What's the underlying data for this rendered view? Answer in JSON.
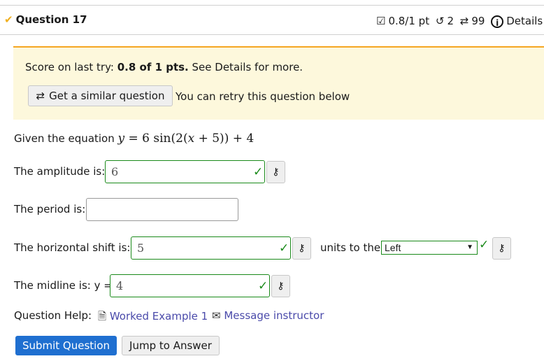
{
  "header": {
    "title": "Question 17",
    "score": "0.8/1 pt",
    "retries": "2",
    "attempts": "99",
    "details": "Details"
  },
  "banner": {
    "score_prefix": "Score on last try: ",
    "score_bold": "0.8 of 1 pts.",
    "score_suffix": " See Details for more.",
    "similar_button": "Get a similar question",
    "retry_text": "You can retry this question below"
  },
  "question": {
    "prompt": "Given the equation ",
    "equation": {
      "lhs": "y",
      "eq": " = 6 sin(2(",
      "x": "x",
      "rest": " + 5)) + 4"
    },
    "amplitude": {
      "label": "The amplitude is:",
      "value": "6",
      "correct": true
    },
    "period": {
      "label": "The period is:",
      "value": ""
    },
    "shift": {
      "label": "The horizontal shift is:",
      "value": "5",
      "correct": true,
      "units_label": "units to the",
      "direction": "Left",
      "direction_correct": true
    },
    "midline": {
      "label": "The midline is: y =",
      "value": "4",
      "correct": true
    }
  },
  "help": {
    "label": "Question Help:",
    "worked_example": "Worked Example 1",
    "message": "Message instructor"
  },
  "actions": {
    "submit": "Submit Question",
    "jump": "Jump to Answer"
  },
  "colors": {
    "accent": "#1f6fd0",
    "correct": "#1a8a1a",
    "banner_bg": "#fdf8dc",
    "banner_border": "#f5a623",
    "link": "#4a4aaa"
  },
  "icons": {
    "key": "key-icon",
    "check": "check-icon",
    "retry": "retry-icon",
    "similar": "similar-icon",
    "info": "info-icon"
  }
}
